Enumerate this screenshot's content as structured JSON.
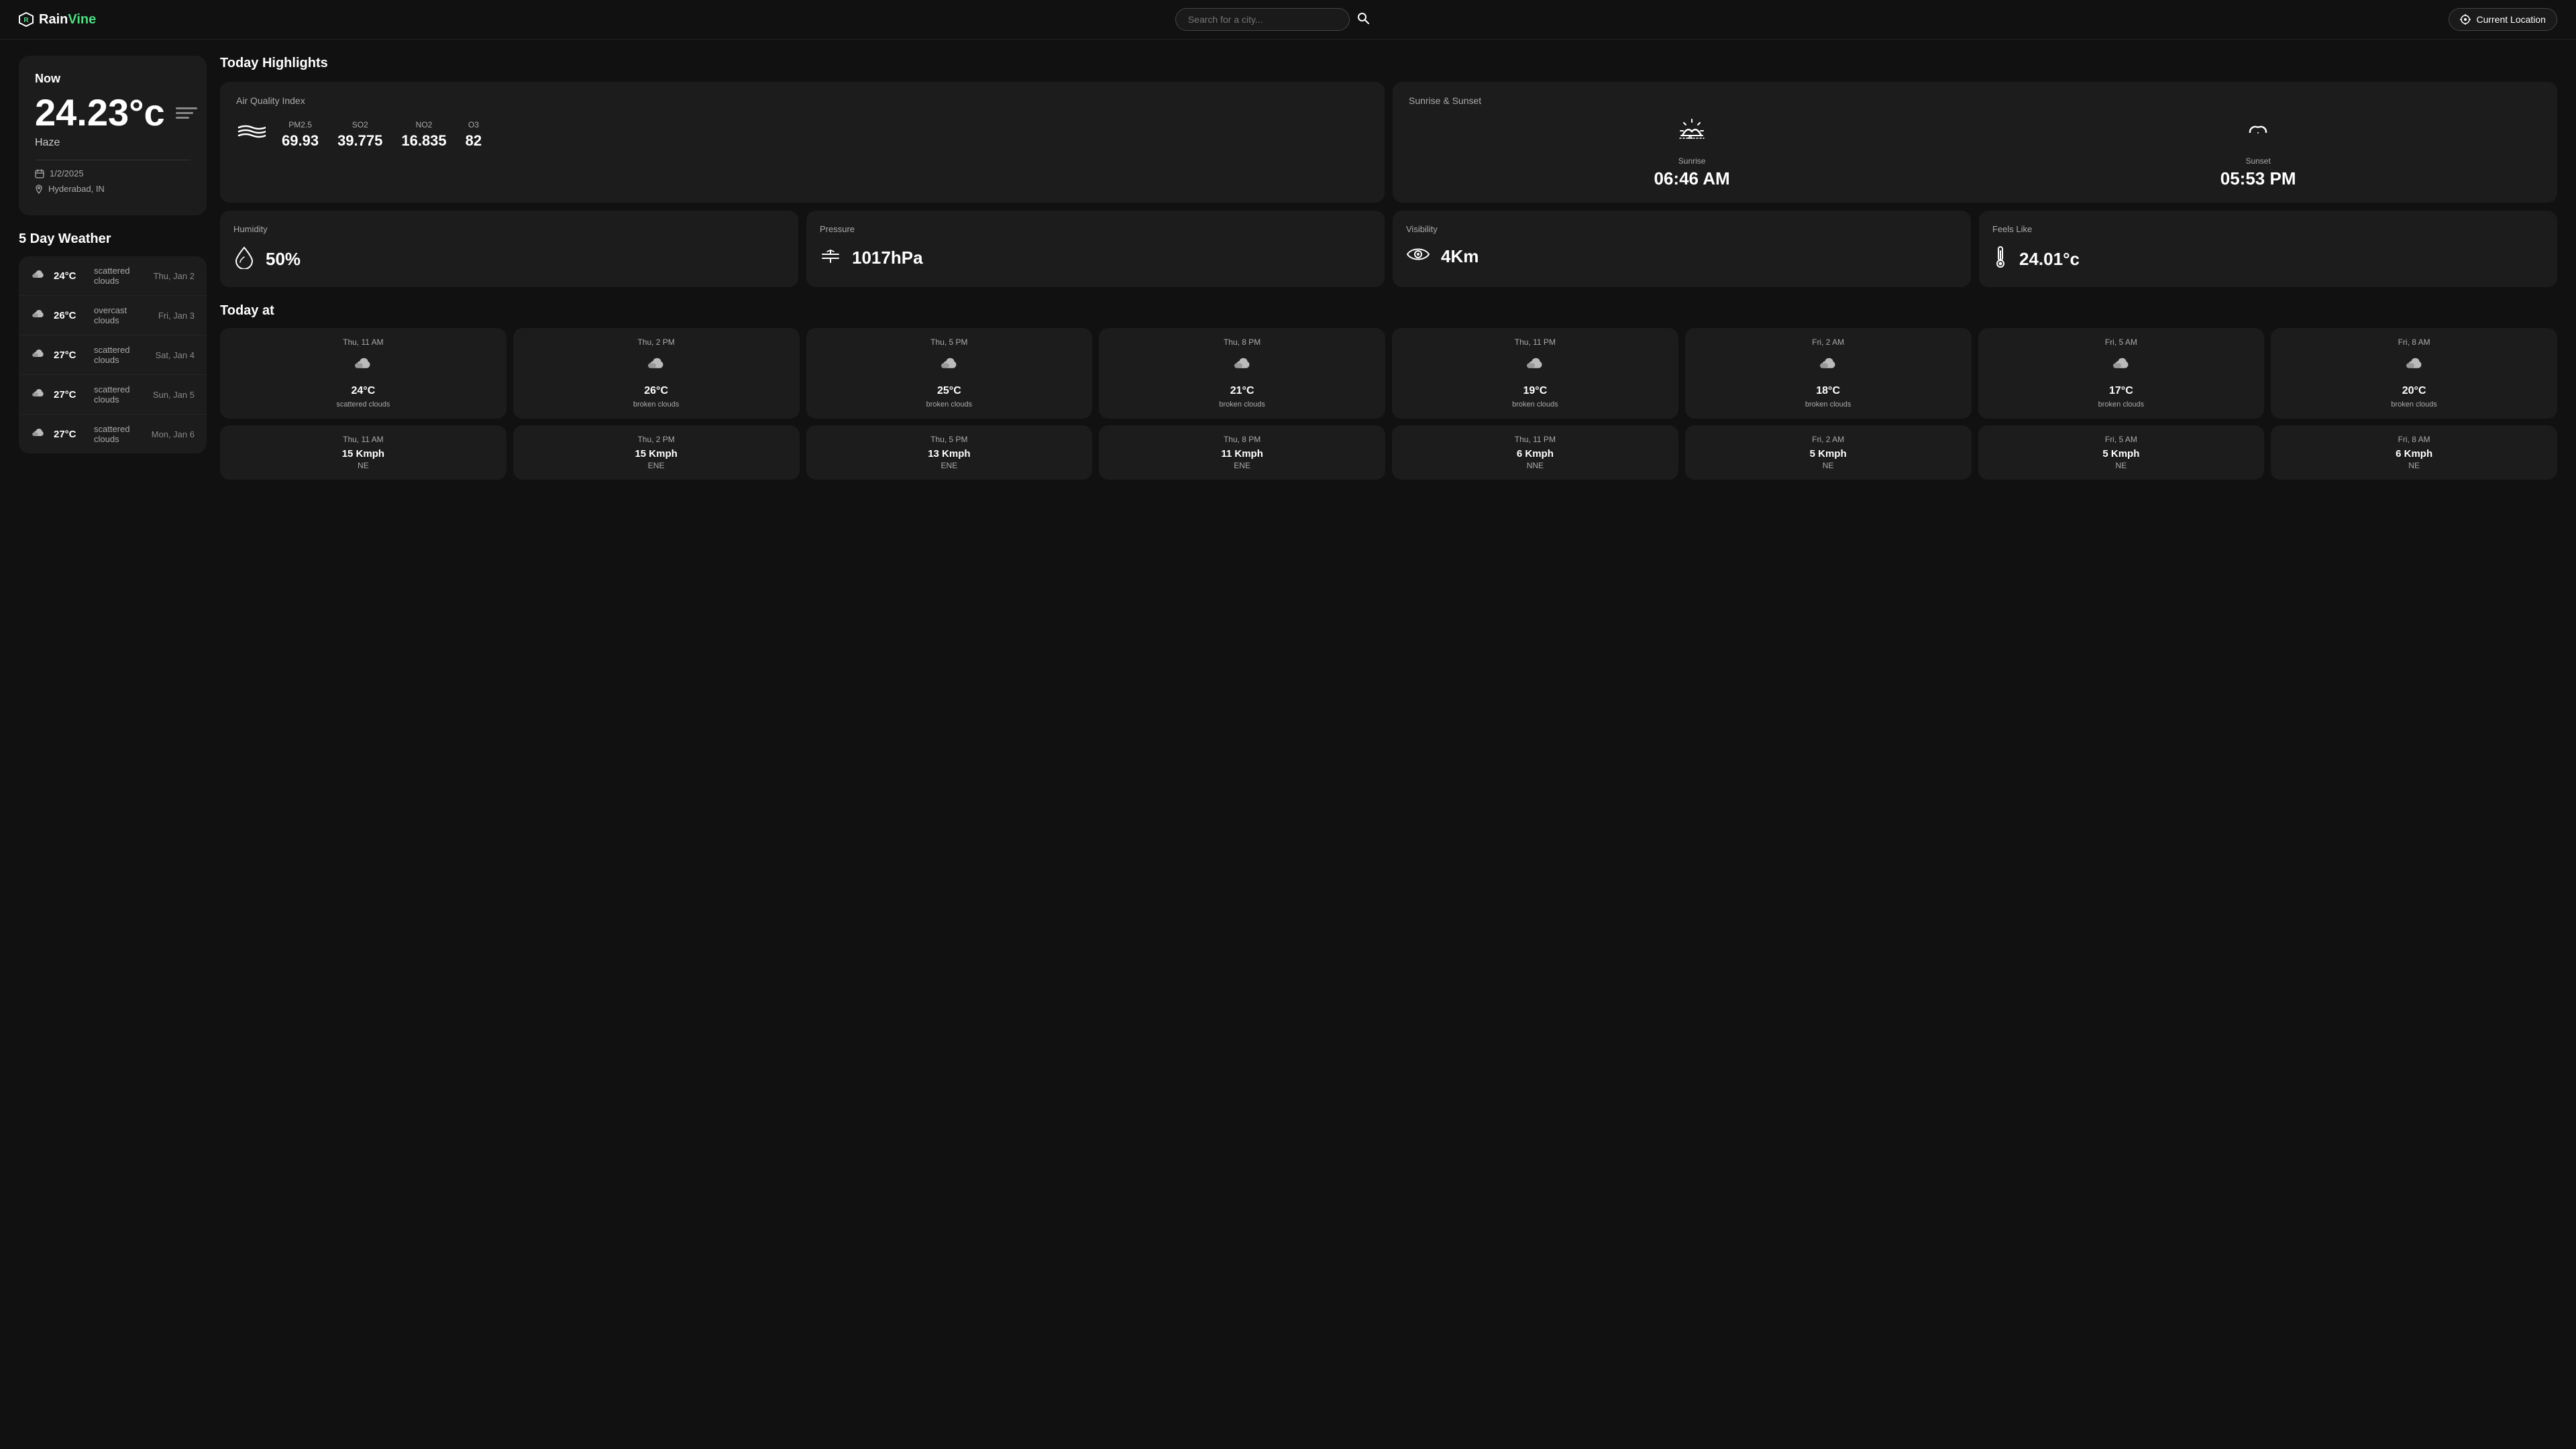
{
  "header": {
    "logo_rain": "Rain",
    "logo_vine": "Vine",
    "search_placeholder": "Search for a city...",
    "location_btn": "Current Location"
  },
  "now": {
    "label": "Now",
    "temperature": "24.23°c",
    "condition": "Haze",
    "date": "1/2/2025",
    "location": "Hyderabad, IN"
  },
  "five_day": {
    "title": "5 Day Weather",
    "days": [
      {
        "temp": "24°C",
        "desc": "scattered clouds",
        "date": "Thu, Jan 2"
      },
      {
        "temp": "26°C",
        "desc": "overcast clouds",
        "date": "Fri, Jan 3"
      },
      {
        "temp": "27°C",
        "desc": "scattered clouds",
        "date": "Sat, Jan 4"
      },
      {
        "temp": "27°C",
        "desc": "scattered clouds",
        "date": "Sun, Jan 5"
      },
      {
        "temp": "27°C",
        "desc": "scattered clouds",
        "date": "Mon, Jan 6"
      }
    ]
  },
  "highlights": {
    "title": "Today Highlights",
    "aqi": {
      "title": "Air Quality Index",
      "pm25_label": "PM2.5",
      "pm25_value": "69.93",
      "so2_label": "SO2",
      "so2_value": "39.775",
      "no2_label": "NO2",
      "no2_value": "16.835",
      "o3_label": "O3",
      "o3_value": "82"
    },
    "sun": {
      "title": "Sunrise & Sunset",
      "sunrise_label": "Sunrise",
      "sunrise_time": "06:46 AM",
      "sunset_label": "Sunset",
      "sunset_time": "05:53 PM"
    },
    "humidity": {
      "title": "Humidity",
      "value": "50%"
    },
    "pressure": {
      "title": "Pressure",
      "value": "1017hPa"
    },
    "visibility": {
      "title": "Visibility",
      "value": "4Km"
    },
    "feels_like": {
      "title": "Feels Like",
      "value": "24.01°c"
    }
  },
  "today_at": {
    "title": "Today at",
    "weather_cards": [
      {
        "time": "Thu, 11 AM",
        "temp": "24°C",
        "desc": "scattered clouds"
      },
      {
        "time": "Thu, 2 PM",
        "temp": "26°C",
        "desc": "broken clouds"
      },
      {
        "time": "Thu, 5 PM",
        "temp": "25°C",
        "desc": "broken clouds"
      },
      {
        "time": "Thu, 8 PM",
        "temp": "21°C",
        "desc": "broken clouds"
      },
      {
        "time": "Thu, 11 PM",
        "temp": "19°C",
        "desc": "broken clouds"
      },
      {
        "time": "Fri, 2 AM",
        "temp": "18°C",
        "desc": "broken clouds"
      },
      {
        "time": "Fri, 5 AM",
        "temp": "17°C",
        "desc": "broken clouds"
      },
      {
        "time": "Fri, 8 AM",
        "temp": "20°C",
        "desc": "broken clouds"
      }
    ],
    "wind_cards": [
      {
        "time": "Thu, 11 AM",
        "speed": "15 Kmph",
        "dir": "NE"
      },
      {
        "time": "Thu, 2 PM",
        "speed": "15 Kmph",
        "dir": "ENE"
      },
      {
        "time": "Thu, 5 PM",
        "speed": "13 Kmph",
        "dir": "ENE"
      },
      {
        "time": "Thu, 8 PM",
        "speed": "11 Kmph",
        "dir": "ENE"
      },
      {
        "time": "Thu, 11 PM",
        "speed": "6 Kmph",
        "dir": "NNE"
      },
      {
        "time": "Fri, 2 AM",
        "speed": "5 Kmph",
        "dir": "NE"
      },
      {
        "time": "Fri, 5 AM",
        "speed": "5 Kmph",
        "dir": "NE"
      },
      {
        "time": "Fri, 8 AM",
        "speed": "6 Kmph",
        "dir": "NE"
      }
    ]
  }
}
